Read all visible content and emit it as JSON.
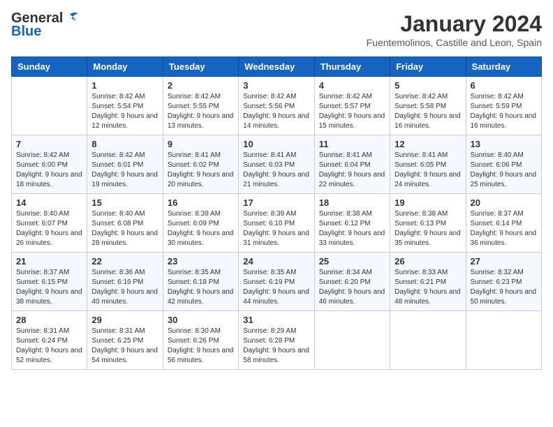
{
  "header": {
    "logo_line1": "General",
    "logo_line2": "Blue",
    "month_year": "January 2024",
    "location": "Fuentemolinos, Castille and Leon, Spain"
  },
  "weekdays": [
    "Sunday",
    "Monday",
    "Tuesday",
    "Wednesday",
    "Thursday",
    "Friday",
    "Saturday"
  ],
  "weeks": [
    [
      {
        "day": "",
        "sunrise": "",
        "sunset": "",
        "daylight": ""
      },
      {
        "day": "1",
        "sunrise": "Sunrise: 8:42 AM",
        "sunset": "Sunset: 5:54 PM",
        "daylight": "Daylight: 9 hours and 12 minutes."
      },
      {
        "day": "2",
        "sunrise": "Sunrise: 8:42 AM",
        "sunset": "Sunset: 5:55 PM",
        "daylight": "Daylight: 9 hours and 13 minutes."
      },
      {
        "day": "3",
        "sunrise": "Sunrise: 8:42 AM",
        "sunset": "Sunset: 5:56 PM",
        "daylight": "Daylight: 9 hours and 14 minutes."
      },
      {
        "day": "4",
        "sunrise": "Sunrise: 8:42 AM",
        "sunset": "Sunset: 5:57 PM",
        "daylight": "Daylight: 9 hours and 15 minutes."
      },
      {
        "day": "5",
        "sunrise": "Sunrise: 8:42 AM",
        "sunset": "Sunset: 5:58 PM",
        "daylight": "Daylight: 9 hours and 16 minutes."
      },
      {
        "day": "6",
        "sunrise": "Sunrise: 8:42 AM",
        "sunset": "Sunset: 5:59 PM",
        "daylight": "Daylight: 9 hours and 16 minutes."
      }
    ],
    [
      {
        "day": "7",
        "sunrise": "Sunrise: 8:42 AM",
        "sunset": "Sunset: 6:00 PM",
        "daylight": "Daylight: 9 hours and 18 minutes."
      },
      {
        "day": "8",
        "sunrise": "Sunrise: 8:42 AM",
        "sunset": "Sunset: 6:01 PM",
        "daylight": "Daylight: 9 hours and 19 minutes."
      },
      {
        "day": "9",
        "sunrise": "Sunrise: 8:41 AM",
        "sunset": "Sunset: 6:02 PM",
        "daylight": "Daylight: 9 hours and 20 minutes."
      },
      {
        "day": "10",
        "sunrise": "Sunrise: 8:41 AM",
        "sunset": "Sunset: 6:03 PM",
        "daylight": "Daylight: 9 hours and 21 minutes."
      },
      {
        "day": "11",
        "sunrise": "Sunrise: 8:41 AM",
        "sunset": "Sunset: 6:04 PM",
        "daylight": "Daylight: 9 hours and 22 minutes."
      },
      {
        "day": "12",
        "sunrise": "Sunrise: 8:41 AM",
        "sunset": "Sunset: 6:05 PM",
        "daylight": "Daylight: 9 hours and 24 minutes."
      },
      {
        "day": "13",
        "sunrise": "Sunrise: 8:40 AM",
        "sunset": "Sunset: 6:06 PM",
        "daylight": "Daylight: 9 hours and 25 minutes."
      }
    ],
    [
      {
        "day": "14",
        "sunrise": "Sunrise: 8:40 AM",
        "sunset": "Sunset: 6:07 PM",
        "daylight": "Daylight: 9 hours and 26 minutes."
      },
      {
        "day": "15",
        "sunrise": "Sunrise: 8:40 AM",
        "sunset": "Sunset: 6:08 PM",
        "daylight": "Daylight: 9 hours and 28 minutes."
      },
      {
        "day": "16",
        "sunrise": "Sunrise: 8:39 AM",
        "sunset": "Sunset: 6:09 PM",
        "daylight": "Daylight: 9 hours and 30 minutes."
      },
      {
        "day": "17",
        "sunrise": "Sunrise: 8:39 AM",
        "sunset": "Sunset: 6:10 PM",
        "daylight": "Daylight: 9 hours and 31 minutes."
      },
      {
        "day": "18",
        "sunrise": "Sunrise: 8:38 AM",
        "sunset": "Sunset: 6:12 PM",
        "daylight": "Daylight: 9 hours and 33 minutes."
      },
      {
        "day": "19",
        "sunrise": "Sunrise: 8:38 AM",
        "sunset": "Sunset: 6:13 PM",
        "daylight": "Daylight: 9 hours and 35 minutes."
      },
      {
        "day": "20",
        "sunrise": "Sunrise: 8:37 AM",
        "sunset": "Sunset: 6:14 PM",
        "daylight": "Daylight: 9 hours and 36 minutes."
      }
    ],
    [
      {
        "day": "21",
        "sunrise": "Sunrise: 8:37 AM",
        "sunset": "Sunset: 6:15 PM",
        "daylight": "Daylight: 9 hours and 38 minutes."
      },
      {
        "day": "22",
        "sunrise": "Sunrise: 8:36 AM",
        "sunset": "Sunset: 6:16 PM",
        "daylight": "Daylight: 9 hours and 40 minutes."
      },
      {
        "day": "23",
        "sunrise": "Sunrise: 8:35 AM",
        "sunset": "Sunset: 6:18 PM",
        "daylight": "Daylight: 9 hours and 42 minutes."
      },
      {
        "day": "24",
        "sunrise": "Sunrise: 8:35 AM",
        "sunset": "Sunset: 6:19 PM",
        "daylight": "Daylight: 9 hours and 44 minutes."
      },
      {
        "day": "25",
        "sunrise": "Sunrise: 8:34 AM",
        "sunset": "Sunset: 6:20 PM",
        "daylight": "Daylight: 9 hours and 46 minutes."
      },
      {
        "day": "26",
        "sunrise": "Sunrise: 8:33 AM",
        "sunset": "Sunset: 6:21 PM",
        "daylight": "Daylight: 9 hours and 48 minutes."
      },
      {
        "day": "27",
        "sunrise": "Sunrise: 8:32 AM",
        "sunset": "Sunset: 6:23 PM",
        "daylight": "Daylight: 9 hours and 50 minutes."
      }
    ],
    [
      {
        "day": "28",
        "sunrise": "Sunrise: 8:31 AM",
        "sunset": "Sunset: 6:24 PM",
        "daylight": "Daylight: 9 hours and 52 minutes."
      },
      {
        "day": "29",
        "sunrise": "Sunrise: 8:31 AM",
        "sunset": "Sunset: 6:25 PM",
        "daylight": "Daylight: 9 hours and 54 minutes."
      },
      {
        "day": "30",
        "sunrise": "Sunrise: 8:30 AM",
        "sunset": "Sunset: 6:26 PM",
        "daylight": "Daylight: 9 hours and 56 minutes."
      },
      {
        "day": "31",
        "sunrise": "Sunrise: 8:29 AM",
        "sunset": "Sunset: 6:28 PM",
        "daylight": "Daylight: 9 hours and 58 minutes."
      },
      {
        "day": "",
        "sunrise": "",
        "sunset": "",
        "daylight": ""
      },
      {
        "day": "",
        "sunrise": "",
        "sunset": "",
        "daylight": ""
      },
      {
        "day": "",
        "sunrise": "",
        "sunset": "",
        "daylight": ""
      }
    ]
  ]
}
